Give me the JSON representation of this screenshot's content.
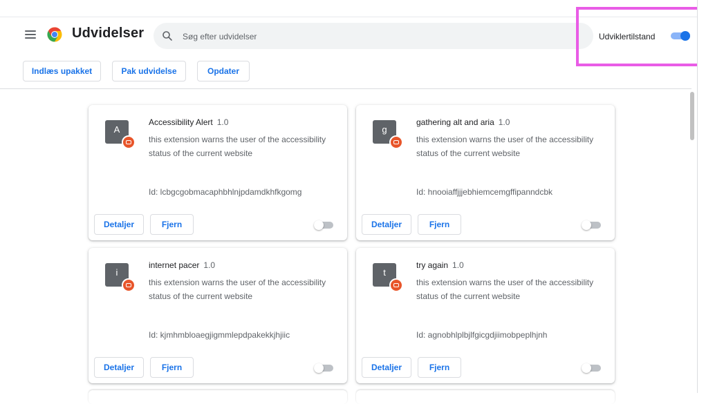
{
  "header": {
    "title": "Udvidelser",
    "search_placeholder": "Søg efter udvidelser",
    "developer_mode_label": "Udviklertilstand",
    "developer_mode_on": true
  },
  "toolbar": {
    "load_unpacked": "Indlæs upakket",
    "pack_extension": "Pak udvidelse",
    "update": "Opdater"
  },
  "colors": {
    "accent": "#1a73e8",
    "highlight_box": "#e95ce6",
    "badge": "#e8552a"
  },
  "card_labels": {
    "details": "Detaljer",
    "remove": "Fjern"
  },
  "extensions": [
    {
      "letter": "A",
      "name": "Accessibility Alert",
      "version": "1.0",
      "description": "this extension warns the user of the accessibility status of the current website",
      "id_text": "Id: lcbgcgobmacaphbhlnjpdamdkhfkgomg",
      "enabled": false
    },
    {
      "letter": "g",
      "name": "gathering alt and aria",
      "version": "1.0",
      "description": "this extension warns the user of the accessibility status of the current website",
      "id_text": "Id: hnooiaffjjjebhiemcemgffipanndcbk",
      "enabled": false
    },
    {
      "letter": "i",
      "name": "internet pacer",
      "version": "1.0",
      "description": "this extension warns the user of the accessibility status of the current website",
      "id_text": "Id: kjmhmbloaegjigmmlepdpakekkjhjiic",
      "enabled": false
    },
    {
      "letter": "t",
      "name": "try again",
      "version": "1.0",
      "description": "this extension warns the user of the accessibility status of the current website",
      "id_text": "Id: agnobhlplbjlfgicgdjiimobpeplhjnh",
      "enabled": false
    }
  ]
}
